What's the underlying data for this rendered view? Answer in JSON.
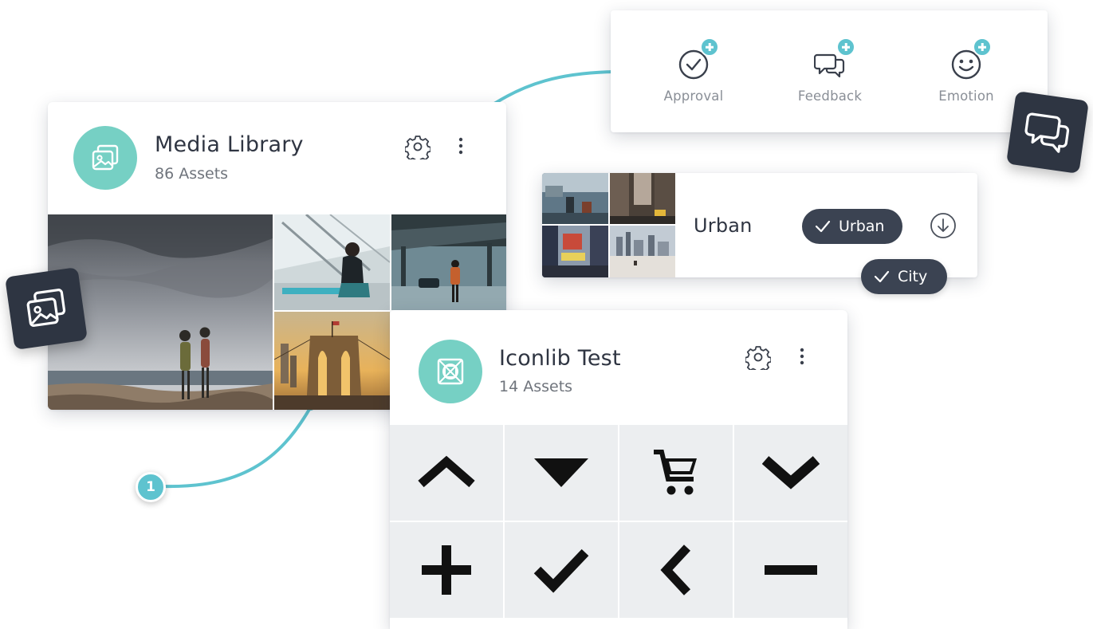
{
  "colors": {
    "accent": "#5ec3cf",
    "avatar": "#76d0c4",
    "dark": "#2e3542",
    "pill": "#3b4352",
    "icon_tile": "#eceef0"
  },
  "reactions": {
    "items": [
      {
        "label": "Approval",
        "icon": "check-circle-icon"
      },
      {
        "label": "Feedback",
        "icon": "speech-bubbles-icon"
      },
      {
        "label": "Emotion",
        "icon": "smiley-icon"
      }
    ]
  },
  "media_library": {
    "title": "Media Library",
    "subtitle": "86 Assets",
    "photos": [
      "seaside-couple-photo",
      "stairs-woman-photo",
      "elevated-train-photo",
      "brooklyn-bridge-photo"
    ]
  },
  "urban": {
    "title": "Urban",
    "tags": [
      "Urban",
      "City"
    ],
    "download_icon": "download-circle-icon"
  },
  "iconlib": {
    "title": "Iconlib Test",
    "subtitle": "14 Assets",
    "icons": [
      "chevron-up-icon",
      "triangle-down-icon",
      "cart-icon",
      "chevron-down-icon",
      "plus-icon",
      "checkmark-icon",
      "chevron-left-icon",
      "minus-icon"
    ]
  },
  "step_marker": "1"
}
